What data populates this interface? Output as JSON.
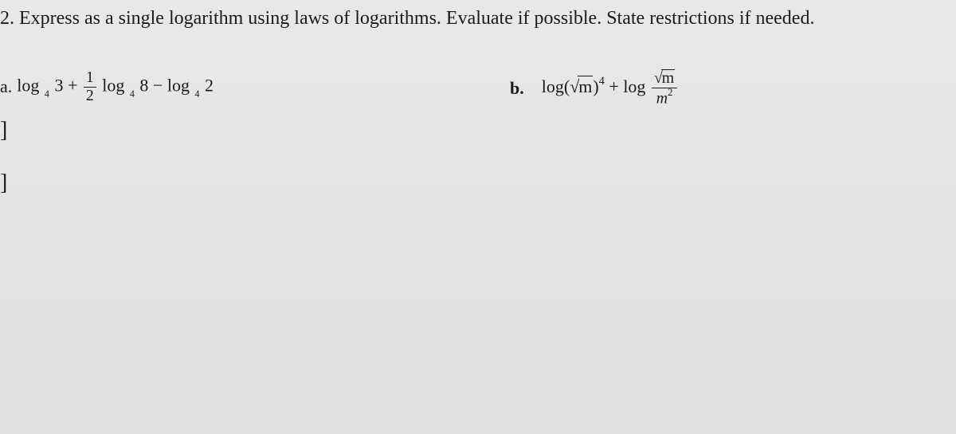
{
  "question": {
    "number": "2.",
    "text": "Express as a single logarithm using laws of logarithms.  Evaluate if possible. State restrictions if needed."
  },
  "parts": {
    "a": {
      "label": "a.",
      "log": "log",
      "base": "4",
      "val1": "3",
      "plus": "+",
      "frac_num": "1",
      "frac_den": "2",
      "val2": "8",
      "minus": "−",
      "val3": "2"
    },
    "b": {
      "label": "b.",
      "log": "log",
      "lparen": "(",
      "sqrt_arg": "m",
      "rparen": ")",
      "exp": "4",
      "plus": "+",
      "frac_num_sqrt_arg": "m",
      "frac_den_base": "m",
      "frac_den_exp": "2"
    }
  },
  "brackets": {
    "b1": "]",
    "b2": "]"
  }
}
